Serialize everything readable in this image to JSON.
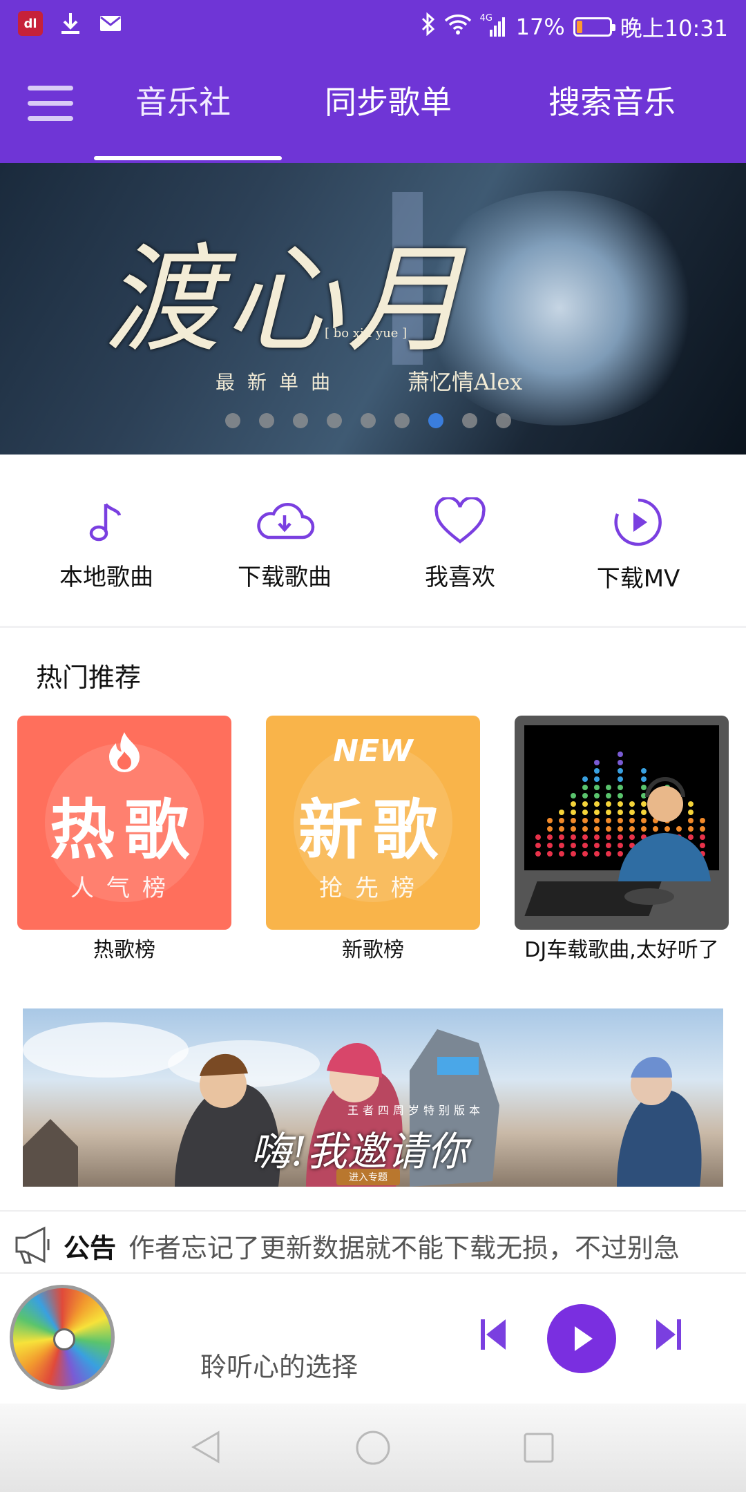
{
  "status_bar": {
    "app_icon_text": "dl",
    "battery_percent": "17%",
    "battery_level": 0.17,
    "network": "4G",
    "time": "晚上10:31"
  },
  "header": {
    "tabs": [
      {
        "label": "音乐社",
        "active": true
      },
      {
        "label": "同步歌单",
        "active": false
      },
      {
        "label": "搜索音乐",
        "active": false
      }
    ]
  },
  "banner": {
    "title": "渡心月",
    "pinyin": "[ bo xin yue ]",
    "subtitle": "最新单曲",
    "artist": "萧忆情Alex",
    "dot_count": 9,
    "active_dot": 7
  },
  "quick_actions": [
    {
      "label": "本地歌曲",
      "icon": "music-note-icon"
    },
    {
      "label": "下载歌曲",
      "icon": "cloud-download-icon"
    },
    {
      "label": "我喜欢",
      "icon": "heart-icon"
    },
    {
      "label": "下载MV",
      "icon": "play-circle-icon"
    }
  ],
  "section": {
    "title": "热门推荐",
    "cards": [
      {
        "label": "热歌榜",
        "big": "热歌",
        "small": "人气榜"
      },
      {
        "label": "新歌榜",
        "big": "新歌",
        "small": "抢先榜",
        "tag": "NEW"
      },
      {
        "label": "DJ车载歌曲,太好听了"
      }
    ]
  },
  "ad": {
    "text": "嗨!我邀请你",
    "small_text": "王者四周岁特别版本",
    "button": "进入专题"
  },
  "notice": {
    "label": "公告",
    "text": "作者忘记了更新数据就不能下载无损，不过别急"
  },
  "player": {
    "text": "聆听心的选择"
  },
  "colors": {
    "primary": "#6f35d6",
    "accent_icon": "#7a3fe0",
    "hot": "#ff6f5c",
    "new": "#f9b44a"
  }
}
